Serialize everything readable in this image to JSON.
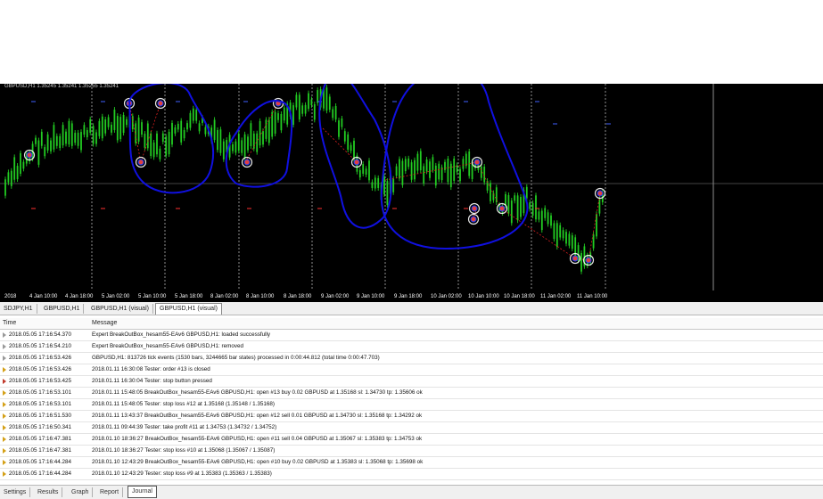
{
  "chart": {
    "info": "GBPUSD,H1  1.35245 1.35241 1.35255 1.35241",
    "xaxis_labels": [
      "2018",
      "4 Jan 10:00",
      "4 Jan 18:00",
      "5 Jan 02:00",
      "5 Jan 10:00",
      "5 Jan 18:00",
      "8 Jan 02:00",
      "8 Jan 10:00",
      "8 Jan 18:00",
      "9 Jan 02:00",
      "9 Jan 10:00",
      "9 Jan 18:00",
      "10 Jan 02:00",
      "10 Jan 10:00",
      "10 Jan 18:00",
      "11 Jan 02:00",
      "11 Jan 10:00"
    ],
    "colors": {
      "background": "#000000",
      "candle": "#22cc22",
      "grid": "#ffffff",
      "annotation": "#1010e0",
      "trade_line": "#dd2020",
      "marker": "#cccccc"
    }
  },
  "chart_tabs": [
    "SDJPY,H1",
    "GBPUSD,H1",
    "GBPUSD,H1 (visual)",
    "GBPUSD,H1 (visual)"
  ],
  "journal": {
    "columns": {
      "time": "Time",
      "message": "Message"
    },
    "rows": [
      {
        "icon": "info",
        "time": "2018.05.05 17:16:54.370",
        "message": "Expert BreakOutBox_hesam55-EAv6 GBPUSD,H1: loaded successfully"
      },
      {
        "icon": "info",
        "time": "2018.05.05 17:16:54.210",
        "message": "Expert BreakOutBox_hesam55-EAv6 GBPUSD,H1: removed"
      },
      {
        "icon": "info",
        "time": "2018.05.05 17:16:53.426",
        "message": "GBPUSD,H1: 813726 tick events (1530 bars, 3244665 bar states) processed in 0:00:44.812 (total time 0:00:47.703)"
      },
      {
        "icon": "warn",
        "time": "2018.05.05 17:16:53.426",
        "message": "2018.01.11 16:30:08  Tester: order #13 is closed"
      },
      {
        "icon": "err",
        "time": "2018.05.05 17:16:53.425",
        "message": "2018.01.11 16:30:04  Tester: stop button pressed"
      },
      {
        "icon": "warn",
        "time": "2018.05.05 17:16:53.101",
        "message": "2018.01.11 15:48:05  BreakOutBox_hesam55-EAv6 GBPUSD,H1: open #13 buy 0.02 GBPUSD at 1.35168 sl: 1.34730 tp: 1.35606 ok"
      },
      {
        "icon": "warn",
        "time": "2018.05.05 17:16:53.101",
        "message": "2018.01.11 15:48:05  Tester: stop loss #12 at 1.35168 (1.35148 / 1.35168)"
      },
      {
        "icon": "warn",
        "time": "2018.05.05 17:16:51.530",
        "message": "2018.01.11 13:43:37  BreakOutBox_hesam55-EAv6 GBPUSD,H1: open #12 sell 0.01 GBPUSD at 1.34730 sl: 1.35168 tp: 1.34292 ok"
      },
      {
        "icon": "warn",
        "time": "2018.05.05 17:16:50.341",
        "message": "2018.01.11 09:44:39  Tester: take profit #11 at 1.34753 (1.34732 / 1.34752)"
      },
      {
        "icon": "warn",
        "time": "2018.05.05 17:16:47.381",
        "message": "2018.01.10 18:36:27  BreakOutBox_hesam55-EAv6 GBPUSD,H1: open #11 sell 0.04 GBPUSD at 1.35067 sl: 1.35383 tp: 1.34753 ok"
      },
      {
        "icon": "warn",
        "time": "2018.05.05 17:16:47.381",
        "message": "2018.01.10 18:36:27  Tester: stop loss #10 at 1.35068 (1.35067 / 1.35087)"
      },
      {
        "icon": "warn",
        "time": "2018.05.05 17:16:44.284",
        "message": "2018.01.10 12:43:29  BreakOutBox_hesam55-EAv6 GBPUSD,H1: open #10 buy 0.02 GBPUSD at 1.35383 sl: 1.35068 tp: 1.35698 ok"
      },
      {
        "icon": "warn",
        "time": "2018.05.05 17:16:44.284",
        "message": "2018.01.10 12:43:29  Tester: stop loss #9 at 1.35383 (1.35363 / 1.35383)"
      }
    ]
  },
  "bottom_tabs": [
    "Settings",
    "Results",
    "Graph",
    "Report",
    "Journal"
  ]
}
